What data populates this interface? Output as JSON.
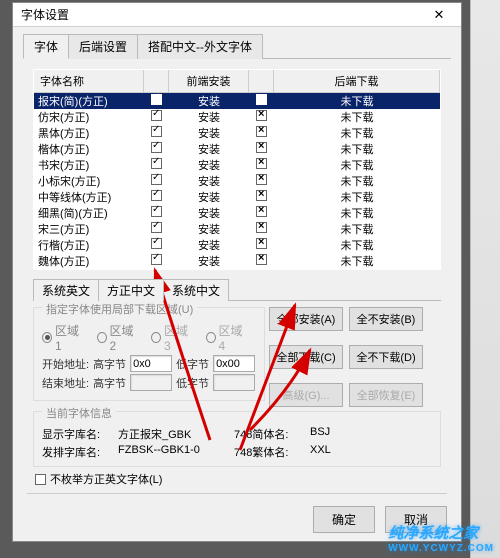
{
  "window": {
    "title": "字体设置"
  },
  "main_tabs": [
    "字体",
    "后端设置",
    "搭配中文--外文字体"
  ],
  "table": {
    "headers": [
      "字体名称",
      "前端安装",
      "后端下载"
    ],
    "rows": [
      {
        "name": "报宋(简)(方正)",
        "install": "安装",
        "download": "未下载",
        "selected": true
      },
      {
        "name": "仿宋(方正)",
        "install": "安装",
        "download": "未下载"
      },
      {
        "name": "黑体(方正)",
        "install": "安装",
        "download": "未下载"
      },
      {
        "name": "楷体(方正)",
        "install": "安装",
        "download": "未下载"
      },
      {
        "name": "书宋(方正)",
        "install": "安装",
        "download": "未下载"
      },
      {
        "name": "小标宋(方正)",
        "install": "安装",
        "download": "未下载"
      },
      {
        "name": "中等线体(方正)",
        "install": "安装",
        "download": "未下载"
      },
      {
        "name": "细黑(简)(方正)",
        "install": "安装",
        "download": "未下载"
      },
      {
        "name": "宋三(方正)",
        "install": "安装",
        "download": "未下载"
      },
      {
        "name": "行楷(方正)",
        "install": "安装",
        "download": "未下载"
      },
      {
        "name": "魏体(方正)",
        "install": "安装",
        "download": "未下载"
      }
    ]
  },
  "sub_tabs": [
    "系统英文",
    "方正中文",
    "系统中文"
  ],
  "region": {
    "legend": "指定字体使用局部下载区域(U)",
    "options": [
      "区域1",
      "区域2",
      "区域3",
      "区域4"
    ],
    "start_label": "开始地址:",
    "end_label": "结束地址:",
    "high_label": "高字节",
    "low_label": "低字节",
    "hi1": "0x0",
    "lo1": "0x00",
    "hi2": "",
    "lo2": ""
  },
  "buttons": {
    "install_all": "全部安装(A)",
    "install_none": "全不安装(B)",
    "download_all": "全部下载(C)",
    "download_none": "全不下载(D)",
    "advanced": "高级(G)...",
    "restore": "全部恢复(E)"
  },
  "current_font": {
    "legend": "当前字体信息",
    "display_k": "显示字库名:",
    "display_v": "方正报宋_GBK",
    "publish_k": "发排字库名:",
    "publish_v": "FZBSK--GBK1-0",
    "simp_k": "748简体名:",
    "simp_v": "BSJ",
    "trad_k": "748繁体名:",
    "trad_v": "XXL"
  },
  "bottom_check": "不枚举方正英文字体(L)",
  "dialog": {
    "ok": "确定",
    "cancel": "取消"
  },
  "watermark": {
    "main": "纯净系统之家",
    "sub": "WWW.YCWYZ.COM"
  }
}
